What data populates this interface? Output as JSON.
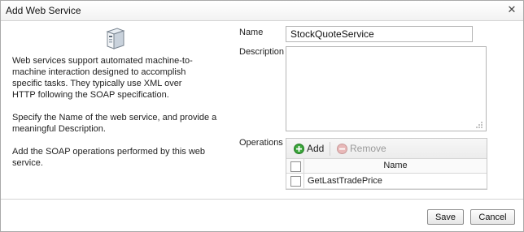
{
  "dialog": {
    "title": "Add Web Service",
    "close_icon": "close-icon"
  },
  "help": {
    "icon": "server-icon",
    "paragraph1": "Web services support automated machine-to-machine interaction designed to accomplish specific tasks. They typically use XML over HTTP following the SOAP specification.",
    "paragraph2": "Specify the Name of the web service, and provide a meaningful Description.",
    "paragraph3": "Add the SOAP operations performed by this web service."
  },
  "form": {
    "name_label": "Name",
    "name_value": "StockQuoteService",
    "description_label": "Description",
    "description_value": "",
    "operations_label": "Operations"
  },
  "operations": {
    "add_label": "Add",
    "remove_label": "Remove",
    "column_name": "Name",
    "rows": [
      {
        "name": "GetLastTradePrice",
        "checked": false
      }
    ]
  },
  "footer": {
    "save_label": "Save",
    "cancel_label": "Cancel"
  },
  "colors": {
    "add_icon": "#3aa63a",
    "remove_icon": "#d9a6a6"
  }
}
